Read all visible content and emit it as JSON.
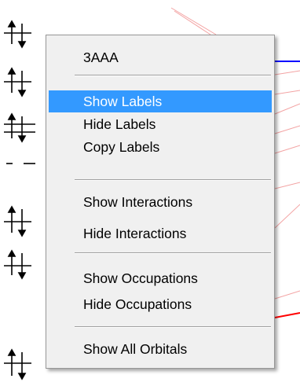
{
  "menu": {
    "title_item": "3AAA",
    "labels_group": [
      "Show Labels",
      "Hide Labels",
      "Copy Labels"
    ],
    "interactions_group": [
      "Show Interactions",
      "Hide Interactions"
    ],
    "occupations_group": [
      "Show Occupations",
      "Hide Occupations"
    ],
    "orbitals_group": [
      "Show All Orbitals"
    ],
    "selected_item": "Show Labels"
  },
  "colors": {
    "selection": "#3399ff",
    "menu_background": "#f0f0f0",
    "orbital_level_blue": "#0000ff",
    "orbital_level_red": "#ff0000",
    "correlation_lines": "#f4a0a0"
  },
  "icons": {
    "orbital_occupancy": "paired-spin-arrows-icon"
  }
}
